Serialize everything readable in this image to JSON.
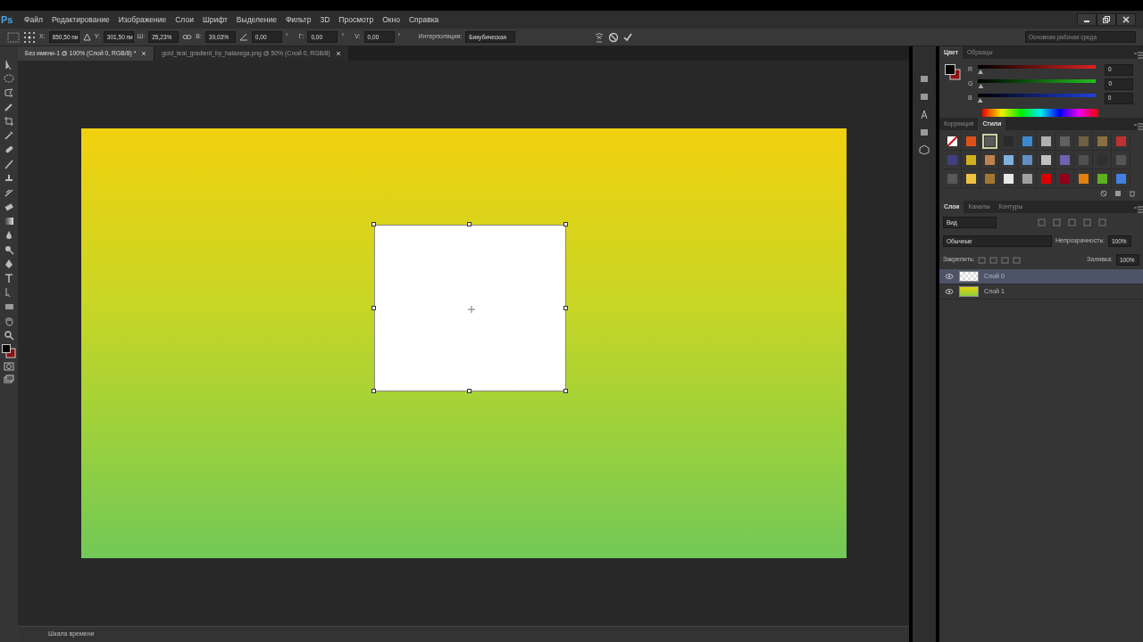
{
  "app": {
    "logo": "Ps"
  },
  "menu": [
    "Файл",
    "Редактирование",
    "Изображение",
    "Слои",
    "Шрифт",
    "Выделение",
    "Фильтр",
    "3D",
    "Просмотр",
    "Окно",
    "Справка"
  ],
  "options_bar": {
    "fields": [
      {
        "kind": "labeled",
        "label": "X:",
        "value": "650,50 пи"
      },
      {
        "kind": "labeled",
        "label": "Y:",
        "value": "301,50 пи"
      },
      {
        "kind": "labeled",
        "label": "Ш:",
        "value": "25,23%"
      },
      {
        "kind": "labeled",
        "label": "В:",
        "value": "39,03%"
      },
      {
        "kind": "angle",
        "value": "0,00",
        "unit": "°"
      },
      {
        "kind": "labeled",
        "label": "Г:",
        "value": "0,00",
        "unit": "°"
      },
      {
        "kind": "labeled",
        "label": "V:",
        "value": "0,00",
        "unit": "°"
      }
    ],
    "interpolation_label": "Интерполяция:",
    "interpolation": "Бикубическая",
    "workspace": "Основная рабочая среда"
  },
  "document_tabs": [
    {
      "title": "Без имени-1 @ 100% (Слой 0, RGB/8) *",
      "selected": true
    },
    {
      "title": "gold_teal_gradient_by_halaxega.png @ 50% (Слой 0, RGB/8)",
      "selected": false
    }
  ],
  "color_panel": {
    "tabs": [
      {
        "label": "Цвет",
        "selected": true
      },
      {
        "label": "Образцы",
        "selected": false
      }
    ],
    "channels": [
      {
        "name": "R",
        "level": 0,
        "value": "0"
      },
      {
        "name": "G",
        "level": 0,
        "value": "0"
      },
      {
        "name": "B",
        "level": 0,
        "value": "0"
      }
    ]
  },
  "styles_panel": {
    "tabs": [
      {
        "label": "Коррекция",
        "selected": false
      },
      {
        "label": "Стили",
        "selected": true
      }
    ],
    "swatches": [
      {
        "kind": "none",
        "color": "#ffffff",
        "selected": false
      },
      {
        "kind": "style",
        "color": "#e0501a",
        "selected": false
      },
      {
        "kind": "style",
        "color": "#5a5a5a",
        "selected": true
      },
      {
        "kind": "style",
        "color": "#2a2a2a",
        "selected": false
      },
      {
        "kind": "style",
        "color": "#3a8ad0",
        "selected": false
      },
      {
        "kind": "style",
        "color": "#b0b0b0",
        "selected": false
      },
      {
        "kind": "style",
        "color": "#606060",
        "selected": false
      },
      {
        "kind": "style",
        "color": "#6e6040",
        "selected": false
      },
      {
        "kind": "style",
        "color": "#8a7040",
        "selected": false
      },
      {
        "kind": "style",
        "color": "#c03030",
        "selected": false
      },
      {
        "kind": "style",
        "color": "#404080",
        "selected": false
      },
      {
        "kind": "style",
        "color": "#d0b020",
        "selected": false
      },
      {
        "kind": "style",
        "color": "#c08050",
        "selected": false
      },
      {
        "kind": "style",
        "color": "#80b0e0",
        "selected": false
      },
      {
        "kind": "style",
        "color": "#6090c0",
        "selected": false
      },
      {
        "kind": "style",
        "color": "#c0c0c0",
        "selected": false
      },
      {
        "kind": "style",
        "color": "#7060b0",
        "selected": false
      },
      {
        "kind": "style",
        "color": "#505050",
        "selected": false
      },
      {
        "kind": "style",
        "color": "#303030",
        "selected": false
      },
      {
        "kind": "style",
        "color": "#555555",
        "selected": false
      },
      {
        "kind": "style",
        "color": "#585858",
        "selected": false
      },
      {
        "kind": "style",
        "color": "#f0c040",
        "selected": false
      },
      {
        "kind": "style",
        "color": "#a07830",
        "selected": false
      },
      {
        "kind": "style",
        "color": "#e8e8e8",
        "selected": false
      },
      {
        "kind": "style",
        "color": "#a0a0a0",
        "selected": false
      },
      {
        "kind": "style",
        "color": "#e00000",
        "selected": false
      },
      {
        "kind": "style",
        "color": "#900018",
        "selected": false
      },
      {
        "kind": "style",
        "color": "#e08010",
        "selected": false
      },
      {
        "kind": "style",
        "color": "#60b020",
        "selected": false
      },
      {
        "kind": "style",
        "color": "#4080e0",
        "selected": false
      }
    ]
  },
  "layers_panel": {
    "tabs": [
      {
        "label": "Слои",
        "selected": true
      },
      {
        "label": "Каналы",
        "selected": false
      },
      {
        "label": "Контуры",
        "selected": false
      }
    ],
    "filter": "Вид",
    "blend_mode": "Обычные",
    "opacity_label": "Непрозрачность:",
    "opacity": "100%",
    "lock_label": "Закрепить:",
    "fill_label": "Заливка:",
    "fill": "100%",
    "layers": [
      {
        "name": "Слой 0",
        "kind": "transparent",
        "visible": true,
        "selected": true
      },
      {
        "name": "Слой 1",
        "kind": "gradient",
        "visible": true,
        "selected": false
      }
    ]
  },
  "timeline": {
    "label": "Шкала времени"
  }
}
